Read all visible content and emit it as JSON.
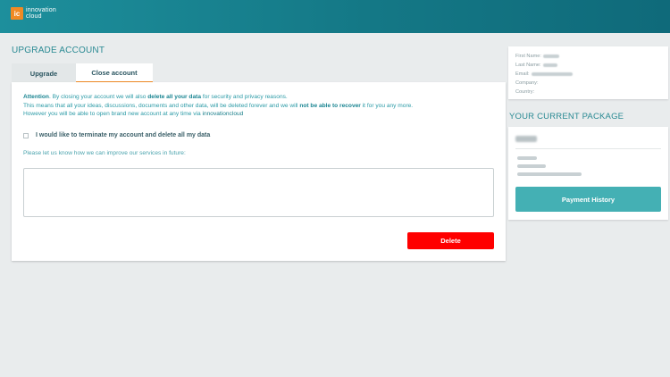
{
  "header": {
    "logo_badge": "ic",
    "logo_line1": "innovation",
    "logo_line2": "cloud"
  },
  "page_title": "UPGRADE ACCOUNT",
  "tabs": [
    {
      "label": "Upgrade",
      "active": false
    },
    {
      "label": "Close account",
      "active": true
    }
  ],
  "close_account": {
    "attention_label": "Attention",
    "warning_part1": ". By closing your account we will also ",
    "warning_bold1": "delete all your data",
    "warning_part2": " for security and privacy reasons.",
    "warning_line2_part1": "This means that all your ideas, discussions, documents and other data, will be deleted forever and we will ",
    "warning_line2_bold": "not be able to recover",
    "warning_line2_part2": " it for you any more.",
    "warning_line3": "However you will be able to open brand new account at any time via ",
    "warning_line3_brand": "innovationcloud",
    "checkbox_label": "I would like to terminate my account and delete all my data",
    "checkbox_checked": false,
    "improve_prompt": "Please let us know how we can improve our services in future:",
    "feedback_value": "",
    "delete_label": "Delete"
  },
  "profile": {
    "first_name_label": "First Name:",
    "last_name_label": "Last Name:",
    "email_label": "Email:",
    "company_label": "Company:",
    "country_label": "Country:"
  },
  "package": {
    "title": "YOUR CURRENT PACKAGE",
    "payment_history_label": "Payment History"
  },
  "colors": {
    "accent": "#2a8a93",
    "header_start": "#1d8f9c",
    "header_end": "#0f6a7a",
    "orange": "#f08a24",
    "delete_red": "#ff0000",
    "button_teal": "#44b0b4"
  }
}
